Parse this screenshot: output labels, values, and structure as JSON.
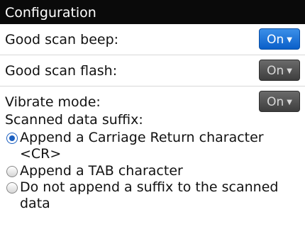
{
  "title": "Configuration",
  "settings": [
    {
      "label": "Good scan beep:",
      "value": "On"
    },
    {
      "label": "Good scan flash:",
      "value": "On"
    },
    {
      "label": "Vibrate mode:",
      "value": "On"
    }
  ],
  "suffix": {
    "label": "Scanned data suffix:",
    "selected_index": 0,
    "options": [
      {
        "line1": "Append a Carriage Return character",
        "line2": "<CR>"
      },
      {
        "line1": "Append a TAB character",
        "line2": ""
      },
      {
        "line1": "Do not append a suffix to the scanned",
        "line2": "data"
      }
    ]
  },
  "icons": {
    "dropdown_caret": "caret-down-icon",
    "radio": "radio-button-icon"
  },
  "colors": {
    "title_bg": "#0a0a0a",
    "active_dropdown": "#0a5fc9",
    "inactive_dropdown": "#4a4a4a",
    "radio_selected": "#1b5fc0"
  }
}
